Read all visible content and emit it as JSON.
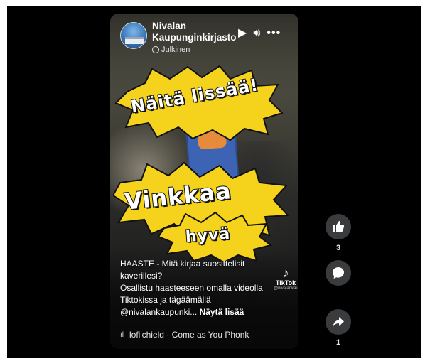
{
  "post": {
    "page_name": "Nivalan Kaupunginkirjasto",
    "privacy": "Julkinen"
  },
  "overlay": {
    "sticker_1": "Näitä lissää!",
    "sticker_2": "Vinkkaa",
    "sticker_3": "hyvä"
  },
  "caption": {
    "line_1": "HAASTE - Mitä kirjaa suosittelisit",
    "line_2": "kaverillesi?",
    "line_3": "Osallistu haasteeseen omalla videolla",
    "line_4": "Tiktokissa ja tägäämällä",
    "line_5": "@nivalankaupunki...",
    "see_more": "Näytä lisää"
  },
  "music": {
    "track": "lofi'chield · Come as You Phonk"
  },
  "watermark": {
    "brand": "TikTok",
    "handle": "@nivalankaupunki"
  },
  "actions": {
    "like_count": "3",
    "share_count": "1"
  },
  "icons": {
    "avatar": "library-building-avatar",
    "play": "play-icon",
    "volume": "volume-icon",
    "more": "more-icon",
    "privacy": "globe-icon",
    "like": "thumbs-up-icon",
    "comment": "comment-icon",
    "share": "share-icon"
  },
  "colors": {
    "background": "#000000",
    "sticker_fill": "#f5d21c",
    "action_button": "#3a3b3c"
  }
}
